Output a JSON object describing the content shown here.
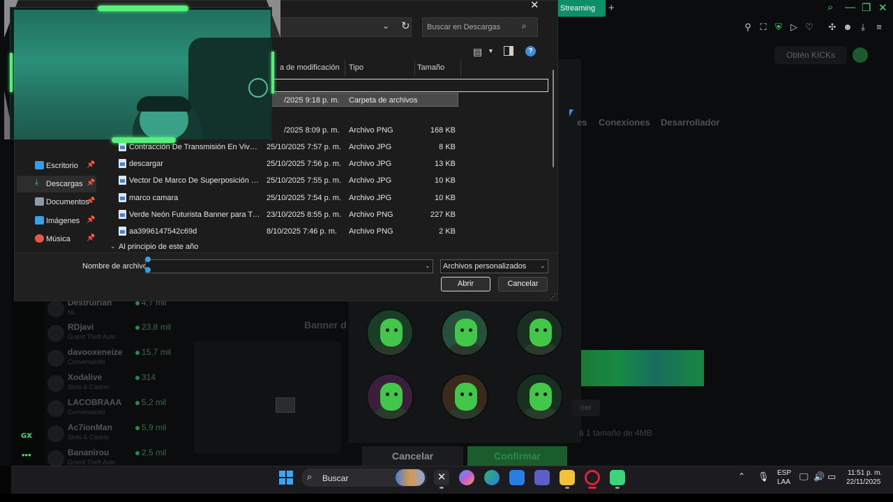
{
  "browser": {
    "active_tab": "Streaming",
    "kick_button": "Obtén KICKs",
    "nav_links": [
      "es",
      "Conexiones",
      "Desarrollador"
    ],
    "banner_label": "Banner d",
    "dim_note": "á 1 tamaño de 4MB",
    "dim_button": "ner",
    "cancel": "Cancelar",
    "confirm": "Confirmar",
    "gx_logo": "GX",
    "gx_more": "•••",
    "streamers": [
      {
        "name": "Destruirian",
        "category": "NL",
        "viewers": "4,7 mil"
      },
      {
        "name": "RDjavi",
        "category": "Grand Theft Auto",
        "viewers": "23,8 mil"
      },
      {
        "name": "davooxeneize",
        "category": "Conversando",
        "viewers": "15,7 mil"
      },
      {
        "name": "Xodalive",
        "category": "Slots & Casino",
        "viewers": "314"
      },
      {
        "name": "LACOBRAAA",
        "category": "Conversando",
        "viewers": "5,2 mil"
      },
      {
        "name": "Ac7ionMan",
        "category": "Slots & Casino",
        "viewers": "5,9 mil"
      },
      {
        "name": "Bananirou",
        "category": "Grand Theft Auto",
        "viewers": "2,5 mil"
      }
    ]
  },
  "dialog": {
    "search_placeholder": "Buscar en Descargas",
    "columns": {
      "date": "a de modificación",
      "type": "Tipo",
      "size": "Tamaño"
    },
    "selected_row": {
      "date": "/2025 9:18 p. m.",
      "type": "Carpeta de archivos"
    },
    "first_row": {
      "date": "/2025 8:09 p. m.",
      "type": "Archivo PNG",
      "size": "168 KB"
    },
    "files": [
      {
        "name": "Contracción De Transmisión En Vivo Sup...",
        "date": "25/10/2025 7:57 p. m.",
        "type": "Archivo JPG",
        "size": "8 KB"
      },
      {
        "name": "descargar",
        "date": "25/10/2025 7:56 p. m.",
        "type": "Archivo JPG",
        "size": "13 KB"
      },
      {
        "name": "Vector De Marco De Superposición De C...",
        "date": "25/10/2025 7:55 p. m.",
        "type": "Archivo JPG",
        "size": "10 KB"
      },
      {
        "name": "marco camara",
        "date": "25/10/2025 7:54 p. m.",
        "type": "Archivo JPG",
        "size": "10 KB"
      },
      {
        "name": "Verde Neón Futurista Banner para Twitch",
        "date": "23/10/2025 8:55 p. m.",
        "type": "Archivo PNG",
        "size": "227 KB"
      },
      {
        "name": "aa3996147542c69d",
        "date": "8/10/2025 7:46 p. m.",
        "type": "Archivo PNG",
        "size": "2 KB"
      }
    ],
    "group_header": "Al principio de este año",
    "nav_items": [
      {
        "label": "Escritorio",
        "color": "#3a9be8"
      },
      {
        "label": "Descargas",
        "color": "#38c47a"
      },
      {
        "label": "Documentos",
        "color": "#8e9aa8"
      },
      {
        "label": "Imágenes",
        "color": "#3aa0e8"
      },
      {
        "label": "Música",
        "color": "#e25a4a"
      }
    ],
    "filename_label": "Nombre de archivo:",
    "filename_value": "",
    "filter": "Archivos personalizados",
    "open": "Abrir",
    "cancel": "Cancelar"
  },
  "taskbar": {
    "search": "Buscar",
    "lang_1": "ESP",
    "lang_2": "LAA",
    "time": "11:51 p. m.",
    "date": "22/11/2025"
  }
}
